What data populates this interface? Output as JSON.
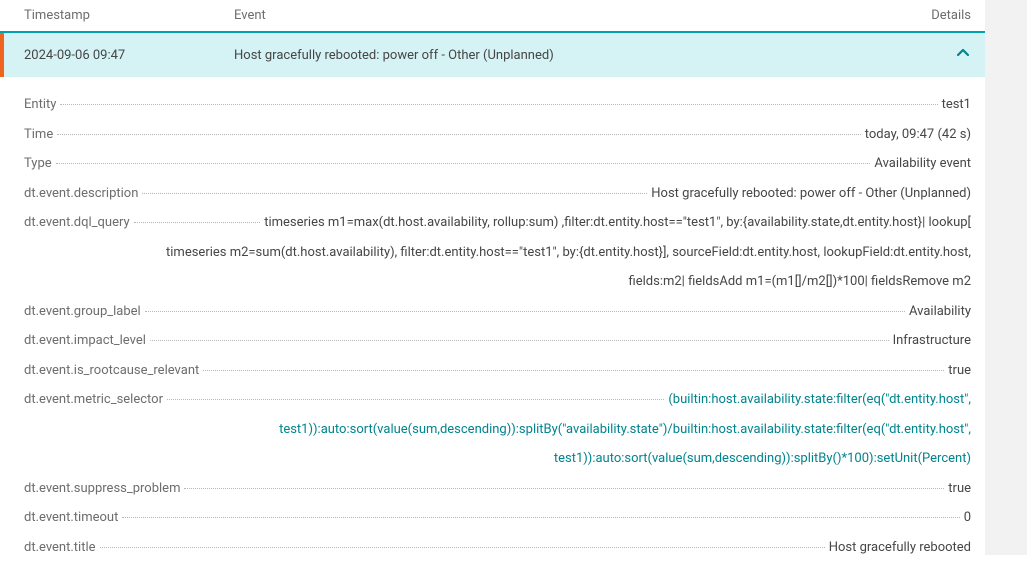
{
  "header": {
    "timestamp": "Timestamp",
    "event": "Event",
    "details": "Details"
  },
  "row": {
    "timestamp": "2024-09-06 09:47",
    "event": "Host gracefully rebooted: power off - Other (Unplanned)"
  },
  "details": {
    "entity": {
      "label": "Entity",
      "value": "test1"
    },
    "time": {
      "label": "Time",
      "value": "today, 09:47 (42 s)"
    },
    "type": {
      "label": "Type",
      "value": "Availability event"
    },
    "description": {
      "label": "dt.event.description",
      "value": "Host gracefully rebooted: power off - Other (Unplanned)"
    },
    "dql_query": {
      "label": "dt.event.dql_query",
      "line1": "timeseries m1=max(dt.host.availability, rollup:sum) ,filter:dt.entity.host==\"test1\", by:{availability.state,dt.entity.host}| lookup[",
      "line2": "timeseries m2=sum(dt.host.availability), filter:dt.entity.host==\"test1\", by:{dt.entity.host}], sourceField:dt.entity.host, lookupField:dt.entity.host,",
      "line3": "fields:m2| fieldsAdd m1=(m1[]/m2[])*100| fieldsRemove m2"
    },
    "group_label": {
      "label": "dt.event.group_label",
      "value": "Availability"
    },
    "impact_level": {
      "label": "dt.event.impact_level",
      "value": "Infrastructure"
    },
    "is_rootcause_relevant": {
      "label": "dt.event.is_rootcause_relevant",
      "value": "true"
    },
    "metric_selector": {
      "label": "dt.event.metric_selector",
      "line1": "(builtin:host.availability.state:filter(eq(\"dt.entity.host\",",
      "line2": "test1)):auto:sort(value(sum,descending)):splitBy(\"availability.state\")/builtin:host.availability.state:filter(eq(\"dt.entity.host\",",
      "line3": "test1)):auto:sort(value(sum,descending)):splitBy()*100):setUnit(Percent)"
    },
    "suppress_problem": {
      "label": "dt.event.suppress_problem",
      "value": "true"
    },
    "timeout": {
      "label": "dt.event.timeout",
      "value": "0"
    },
    "title": {
      "label": "dt.event.title",
      "value": "Host gracefully rebooted"
    }
  }
}
